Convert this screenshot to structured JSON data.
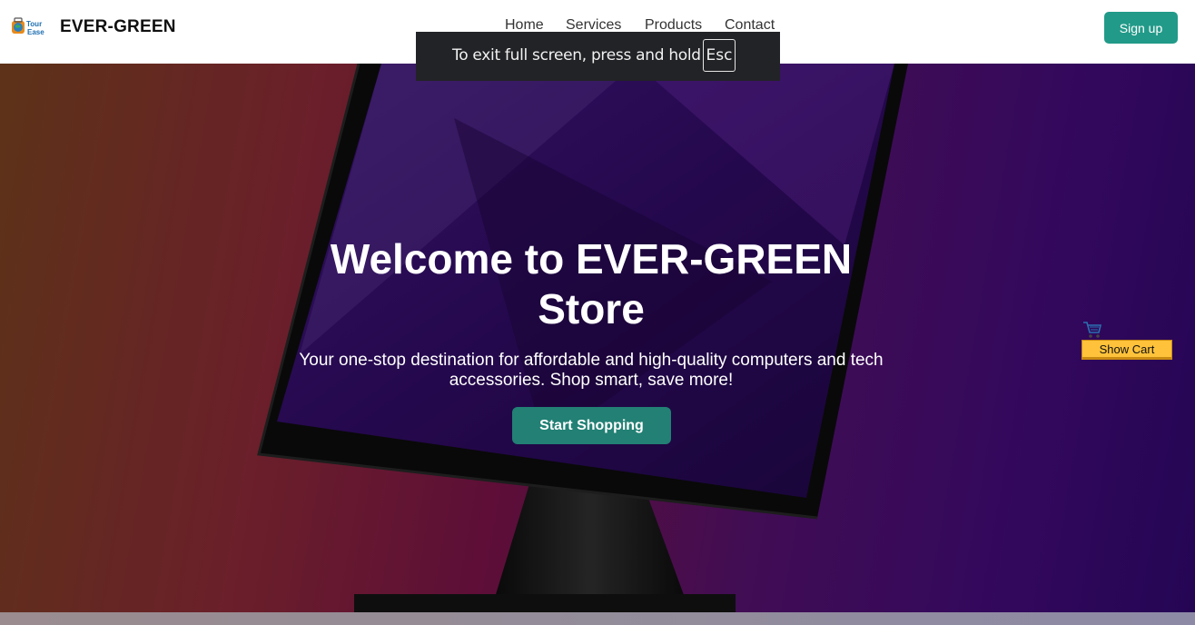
{
  "header": {
    "brand": "EVER-GREEN",
    "logo_text_top": "Tour",
    "logo_text_bottom": "Ease",
    "nav": [
      {
        "label": "Home"
      },
      {
        "label": "Services"
      },
      {
        "label": "Products"
      },
      {
        "label": "Contact"
      }
    ],
    "signup_label": "Sign up"
  },
  "fullscreen_notice": {
    "text": "To exit full screen, press and hold",
    "key": "Esc"
  },
  "hero": {
    "title": "Welcome to EVER-GREEN Store",
    "subtitle": "Your one-stop destination for affordable and high-quality computers and tech accessories. Shop smart, save more!",
    "cta_label": "Start Shopping"
  },
  "cart": {
    "icon": "shopping-cart-icon",
    "button_label": "Show Cart"
  },
  "colors": {
    "accent": "#229a89",
    "cta": "#228074",
    "cart_button": "#ffc23a"
  }
}
